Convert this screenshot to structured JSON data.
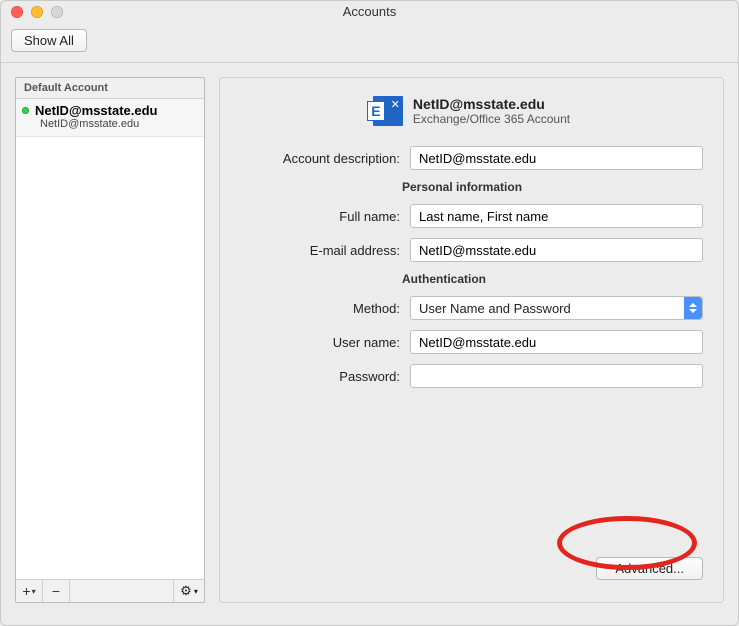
{
  "window": {
    "title": "Accounts",
    "show_all_label": "Show All"
  },
  "sidebar": {
    "header": "Default Account",
    "account": {
      "name_prefix": "NetID",
      "name_suffix": "@msstate.edu",
      "sub_prefix": "NetID",
      "sub_suffix": "@msstate.edu"
    },
    "footer": {
      "add": "+",
      "remove": "−",
      "gear": "⚙︎",
      "gear_arrow": "▾"
    }
  },
  "main": {
    "icon_name": "exchange-icon",
    "title_prefix": "NetID",
    "title_suffix": "@msstate.edu",
    "subtitle": "Exchange/Office 365 Account",
    "labels": {
      "account_description": "Account description:",
      "personal_info": "Personal information",
      "full_name": "Full name:",
      "email": "E-mail address:",
      "authentication": "Authentication",
      "method": "Method:",
      "username": "User name:",
      "password": "Password:"
    },
    "values": {
      "account_description_prefix": "NetID",
      "account_description_suffix": "@msstate.edu",
      "full_name": "Last name, First name",
      "email_prefix": "NetID",
      "email_suffix": "@msstate.edu",
      "method": "User Name and Password",
      "username_prefix": "NetID",
      "username_suffix": "@msstate.edu",
      "password": ""
    },
    "advanced_label": "Advanced..."
  }
}
